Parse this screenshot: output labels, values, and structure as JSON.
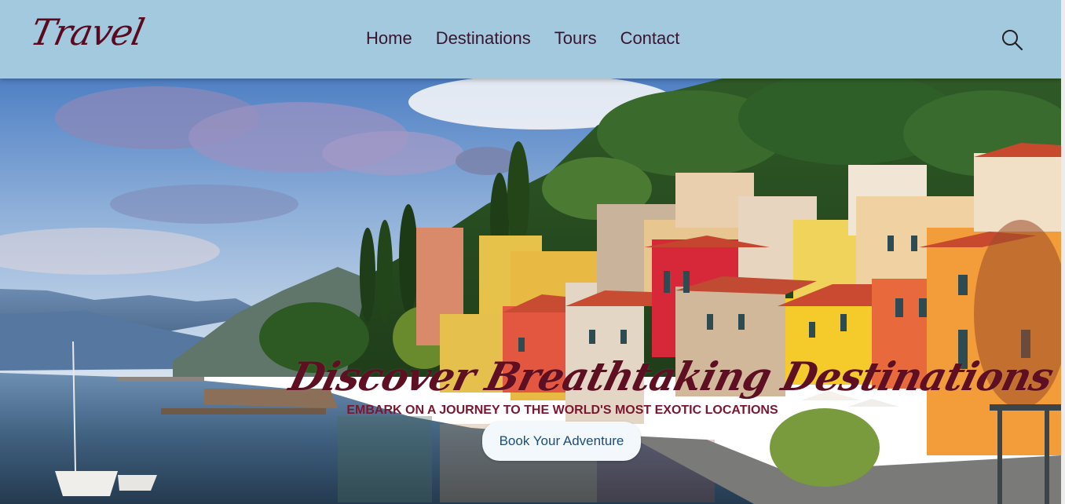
{
  "header": {
    "logo": "Travel",
    "nav": [
      {
        "label": "Home"
      },
      {
        "label": "Destinations"
      },
      {
        "label": "Tours"
      },
      {
        "label": "Contact"
      }
    ],
    "search_icon": "search-icon"
  },
  "hero": {
    "title": "Discover Breathtaking Destinations",
    "subtitle": "EMBARK ON A JOURNEY TO THE WORLD'S MOST EXOTIC LOCATIONS",
    "cta_label": "Book Your Adventure",
    "image": "lakeside-village-scene"
  },
  "colors": {
    "navbar": "#a3c9de",
    "logo": "#5a0a1e",
    "nav_text": "#3a1530",
    "title": "#5e0f22",
    "subtitle": "#7a1630",
    "cta_bg": "#f2f8fb",
    "cta_text": "#1d4e7a"
  }
}
